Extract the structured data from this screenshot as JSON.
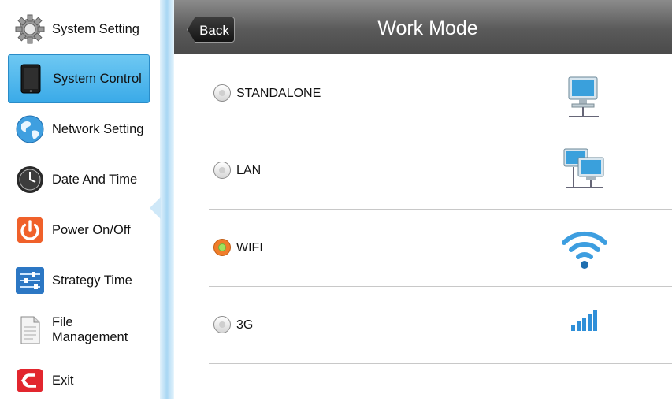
{
  "sidebar": {
    "items": [
      {
        "label": "System Setting",
        "icon": "gear-icon",
        "active": false
      },
      {
        "label": "System Control",
        "icon": "tablet-icon",
        "active": true
      },
      {
        "label": "Network Setting",
        "icon": "globe-icon",
        "active": false
      },
      {
        "label": "Date And Time",
        "icon": "clock-icon",
        "active": false
      },
      {
        "label": "Power On/Off",
        "icon": "power-icon",
        "active": false
      },
      {
        "label": "Strategy Time",
        "icon": "sliders-icon",
        "active": false
      },
      {
        "label": "File\nManagement",
        "icon": "document-icon",
        "active": false
      },
      {
        "label": "Exit",
        "icon": "exit-icon",
        "active": false
      }
    ]
  },
  "header": {
    "back_label": "Back",
    "title": "Work Mode"
  },
  "options": [
    {
      "label": "STANDALONE",
      "selected": false,
      "icon": "computer-icon"
    },
    {
      "label": "LAN",
      "selected": false,
      "icon": "network-computers-icon"
    },
    {
      "label": "WIFI",
      "selected": true,
      "icon": "wifi-icon"
    },
    {
      "label": "3G",
      "selected": false,
      "icon": "signal-bars-icon"
    }
  ],
  "colors": {
    "active_item": "#3aaae8",
    "selected_radio": "#f07d2a",
    "header": "#5a5a5a"
  }
}
